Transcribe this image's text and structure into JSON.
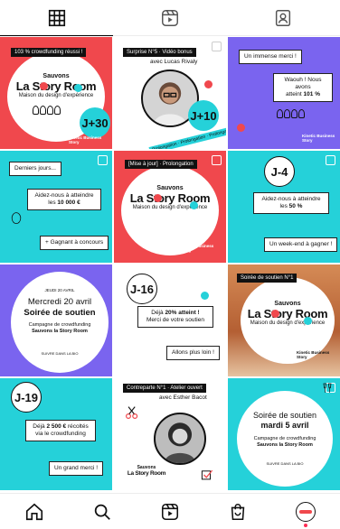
{
  "tabs": [
    {
      "name": "grid",
      "icon": "grid-icon",
      "active": true
    },
    {
      "name": "reels",
      "icon": "reels-icon",
      "active": false
    },
    {
      "name": "tagged",
      "icon": "tagged-person-icon",
      "active": false
    }
  ],
  "posts": {
    "p1": {
      "ticket": "103 % crowdfunding réussi !",
      "brand_line1": "Sauvons",
      "brand_line2": "La Story Room",
      "brand_line3": "Maison du design d'expérience",
      "badge": "J+30",
      "logo": "Kinetic Business Story"
    },
    "p2": {
      "ticket": "Surprise N°5 · Vidéo bonus",
      "guest": "avec Lucas Rivaly",
      "badge": "J+10",
      "banner": "Prolongation · Prolongation · Prolongation"
    },
    "p3": {
      "card1": "Un immense merci !",
      "card2_line1": "Waouh ! Nous avons",
      "card2_line2": "atteint",
      "card2_bold": "101 %",
      "logo": "Kinetic Business Story"
    },
    "p4": {
      "card1": "Derniers jours...",
      "card2_line1": "Aidez-nous à atteindre",
      "card2_line2": "les",
      "card2_bold": "10 000 €",
      "card3": "+ Gagnant à concours"
    },
    "p5": {
      "ticket": "[Mise à jour] · Prolongation",
      "brand_line1": "Sauvons",
      "brand_line2": "La Story Room",
      "brand_line3": "Maison du design d'expérience",
      "logo": "Kinetic Business Story"
    },
    "p6": {
      "badge": "J-4",
      "card1_line1": "Aidez-nous à atteindre",
      "card1_line2": "les",
      "card1_bold": "50 %",
      "card2": "Un week-end à gagner !"
    },
    "p7": {
      "date_small": "JEUDI 20 AVRIL",
      "title_line1": "Mercredi 20 avril",
      "title_line2": "Soirée de soutien",
      "desc_line1": "Campagne de crowdfunding",
      "desc_bold": "Sauvons la Story Room",
      "footer": "SUIVRE DANS LA BIO"
    },
    "p8": {
      "badge": "J-16",
      "card1_line1": "Déjà",
      "card1_bold": "20% atteint !",
      "card1_line2": "Merci de votre soutien",
      "card2": "Allons plus loin !"
    },
    "p9": {
      "ticket": "Soirée de soutien N°1",
      "brand_line1": "Sauvons",
      "brand_line2": "La Story Room",
      "brand_line3": "Maison du design d'expérience",
      "logo": "Kinetic Business Story"
    },
    "p10": {
      "badge": "J-19",
      "card1_line1": "Déjà",
      "card1_bold": "2 500 €",
      "card1_line1b": "récoltés",
      "card1_line2": "via le crowdfunding",
      "card2": "Un grand merci !"
    },
    "p11": {
      "ticket": "Contreparte N°1 · Atelier ouvert",
      "guest": "avec Esther Bacot",
      "brand_line1": "Sauvons",
      "brand_line2": "La Story Room"
    },
    "p12": {
      "title_line1": "Soirée de soutien",
      "title_line2": "mardi 5 avril",
      "desc_line1": "Campagne de crowdfunding",
      "desc_bold": "Sauvons la Story Room",
      "footer": "SUIVRE DANS LA BIO"
    }
  },
  "bottom_nav": [
    {
      "name": "home",
      "icon": "home-icon"
    },
    {
      "name": "search",
      "icon": "search-icon"
    },
    {
      "name": "reels",
      "icon": "reels-icon"
    },
    {
      "name": "shop",
      "icon": "shopping-bag-icon"
    },
    {
      "name": "profile",
      "icon": "profile-avatar-icon"
    }
  ],
  "colors": {
    "red": "#f0484d",
    "cyan": "#25d1d9",
    "violet": "#7a64ef",
    "black": "#111111"
  }
}
